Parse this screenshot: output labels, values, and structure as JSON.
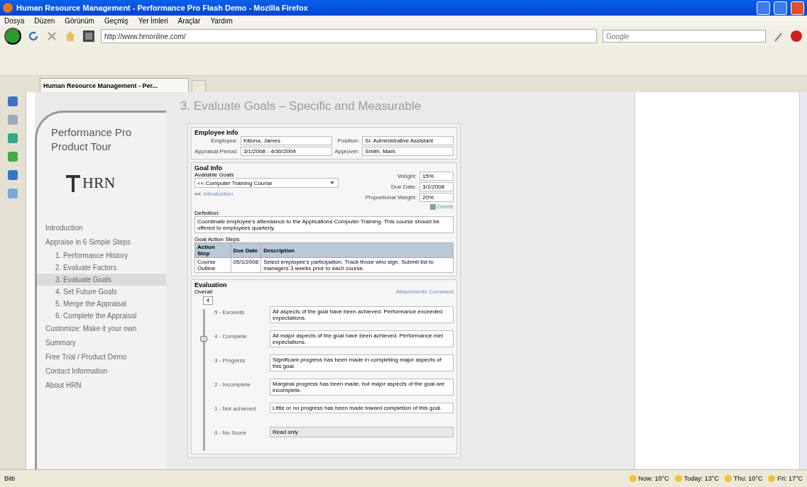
{
  "window": {
    "title": "Human Resource Management - Performance Pro Flash Demo - Mozilla Firefox"
  },
  "menu": [
    "Dosya",
    "Düzen",
    "Görünüm",
    "Geçmiş",
    "Yer İmleri",
    "Araçlar",
    "Yardım"
  ],
  "address": {
    "value": "http://www.hrnonline.com/"
  },
  "search": {
    "placeholder": "Google"
  },
  "tab": {
    "title": "Human Resource Management - Per..."
  },
  "nav": {
    "title": "Performance Pro Product Tour",
    "logo": "HRN",
    "items": [
      {
        "label": "Introduction",
        "selected": false
      },
      {
        "label": "Appraise in 6 Simple Steps",
        "selected": false,
        "children": [
          {
            "label": "1. Performance History",
            "selected": false
          },
          {
            "label": "2. Evaluate Factors",
            "selected": false
          },
          {
            "label": "3. Evaluate Goals",
            "selected": true
          },
          {
            "label": "4. Set Future Goals",
            "selected": false
          },
          {
            "label": "5. Merge the Appraisal",
            "selected": false
          },
          {
            "label": "6. Complete the Appraisal",
            "selected": false
          }
        ]
      },
      {
        "label": "Customize: Make it your own",
        "selected": false
      },
      {
        "label": "Summary",
        "selected": false
      },
      {
        "label": "Free Trial / Product Demo",
        "selected": false
      },
      {
        "label": "Contact Information",
        "selected": false
      },
      {
        "label": "About HRN",
        "selected": false
      }
    ]
  },
  "page": {
    "heading": "3. Evaluate Goals – Specific and Measurable",
    "employee_info": {
      "title": "Employee Info",
      "fields": [
        {
          "label": "Employee:",
          "value": "Kiliona, James"
        },
        {
          "label": "Position:",
          "value": "Sr. Administrative Assistant"
        },
        {
          "label": "Appraisal Period:",
          "value": "3/1/2008 - 4/30/2009"
        },
        {
          "label": "Approver:",
          "value": "Smith, Mark"
        }
      ]
    },
    "goal_info": {
      "title": "Goal Info",
      "available_label": "Available Goals",
      "goal": "<< Computer Training Course",
      "link_prefix": "<<",
      "link": "Introduction",
      "fields": [
        {
          "label": "Weight:",
          "value": "15%"
        },
        {
          "label": "Due Date:",
          "value": "3/1/2008"
        },
        {
          "label": "Proportional Weight:",
          "value": "20%"
        }
      ],
      "delete": "Delete",
      "definition_label": "Definition:",
      "definition": "Coordinate employee's attendance to the Applications Computer Training. This course should be offered to employees quarterly.",
      "steps_label": "Goal Action Steps",
      "columns": [
        "Action Step",
        "Due Date",
        "Description"
      ],
      "rows": [
        [
          "Course Outline",
          "05/1/2008",
          "Select employee's participation. Track those who sign. Submit list to managers 3 weeks prior to each course."
        ]
      ]
    },
    "evaluation": {
      "title": "Evaluation",
      "overall_label": "Overall",
      "overall": "4",
      "link": "Attachments Comment",
      "level": 0.8,
      "scale": [
        {
          "label": "5 - Exceeds",
          "description": "All aspects of the goal have been achieved. Performance exceeded expectations."
        },
        {
          "label": "4 - Complete",
          "description": "All major aspects of the goal have been achieved. Performance met expectations."
        },
        {
          "label": "3 - Progress",
          "description": "Significant progress has been made in completing major aspects of this goal."
        },
        {
          "label": "2 - Incomplete",
          "description": "Marginal progress has been made, but major aspects of the goal are incomplete."
        },
        {
          "label": "1 - Not achieved",
          "description": "Little or no progress has been made toward completion of this goal."
        },
        {
          "label": "0 - No Score",
          "description": "Read only"
        }
      ]
    }
  },
  "status_bar": {
    "text": "Bitti",
    "weather": [
      "Now: 10°C",
      "Today: 13°C",
      "Thu: 10°C",
      "Fri: 17°C"
    ]
  }
}
